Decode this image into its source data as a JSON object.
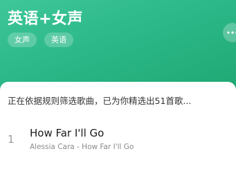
{
  "playlist": {
    "title": "英语+女声",
    "tags": [
      "女声",
      "英语"
    ],
    "more_icon": "more-dots-icon"
  },
  "status": {
    "text": "正在依据规则筛选歌曲，已为你精选出51首歌..."
  },
  "songs": [
    {
      "index": "1",
      "title": "How Far I'll Go",
      "subtitle": "Alessia Cara - How Far I'll Go"
    }
  ],
  "colors": {
    "header_gradient_start": "#3fc79a",
    "header_gradient_end": "#1fa873"
  }
}
